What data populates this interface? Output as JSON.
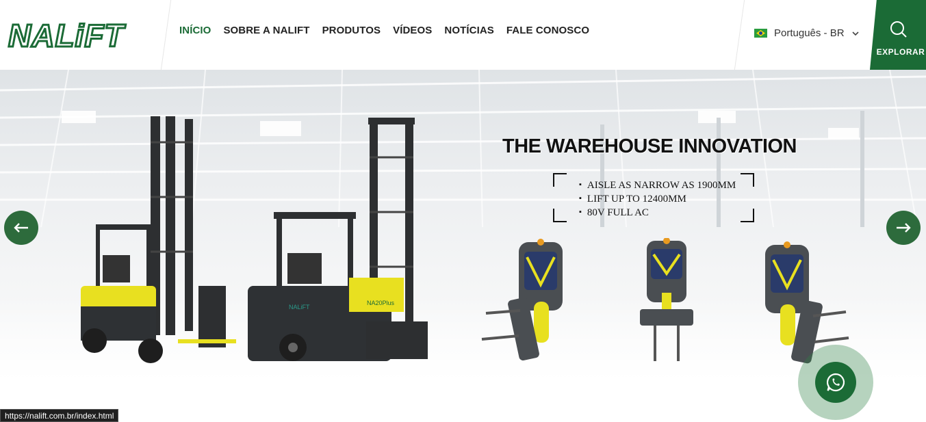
{
  "header": {
    "logo_text": "NALiFT",
    "nav": [
      {
        "label": "INÍCIO",
        "active": true
      },
      {
        "label": "SOBRE A NALIFT",
        "active": false
      },
      {
        "label": "PRODUTOS",
        "active": false
      },
      {
        "label": "VÍDEOS",
        "active": false
      },
      {
        "label": "NOTÍCIAS",
        "active": false
      },
      {
        "label": "FALE CONOSCO",
        "active": false
      }
    ],
    "language": {
      "label": "Português - BR",
      "flag_icon": "brazil-flag-icon"
    },
    "explore": {
      "label": "EXPLORAR",
      "icon": "search-icon"
    }
  },
  "hero": {
    "title": "THE WAREHOUSE INNOVATION",
    "specs": [
      "AISLE AS NARROW AS 1900MM",
      "LIFT UP TO 12400MM",
      "80V FULL AC"
    ],
    "truck_label": "NALiFT",
    "truck_model": "NA20Plus",
    "prev_icon": "arrow-left-icon",
    "next_icon": "arrow-right-icon"
  },
  "whatsapp": {
    "icon": "whatsapp-icon"
  },
  "status_bar": {
    "url": "https://nalift.com.br/index.html"
  },
  "colors": {
    "brand_green": "#1b6b36",
    "truck_yellow": "#f0e020",
    "truck_gray": "#3a3d40"
  }
}
